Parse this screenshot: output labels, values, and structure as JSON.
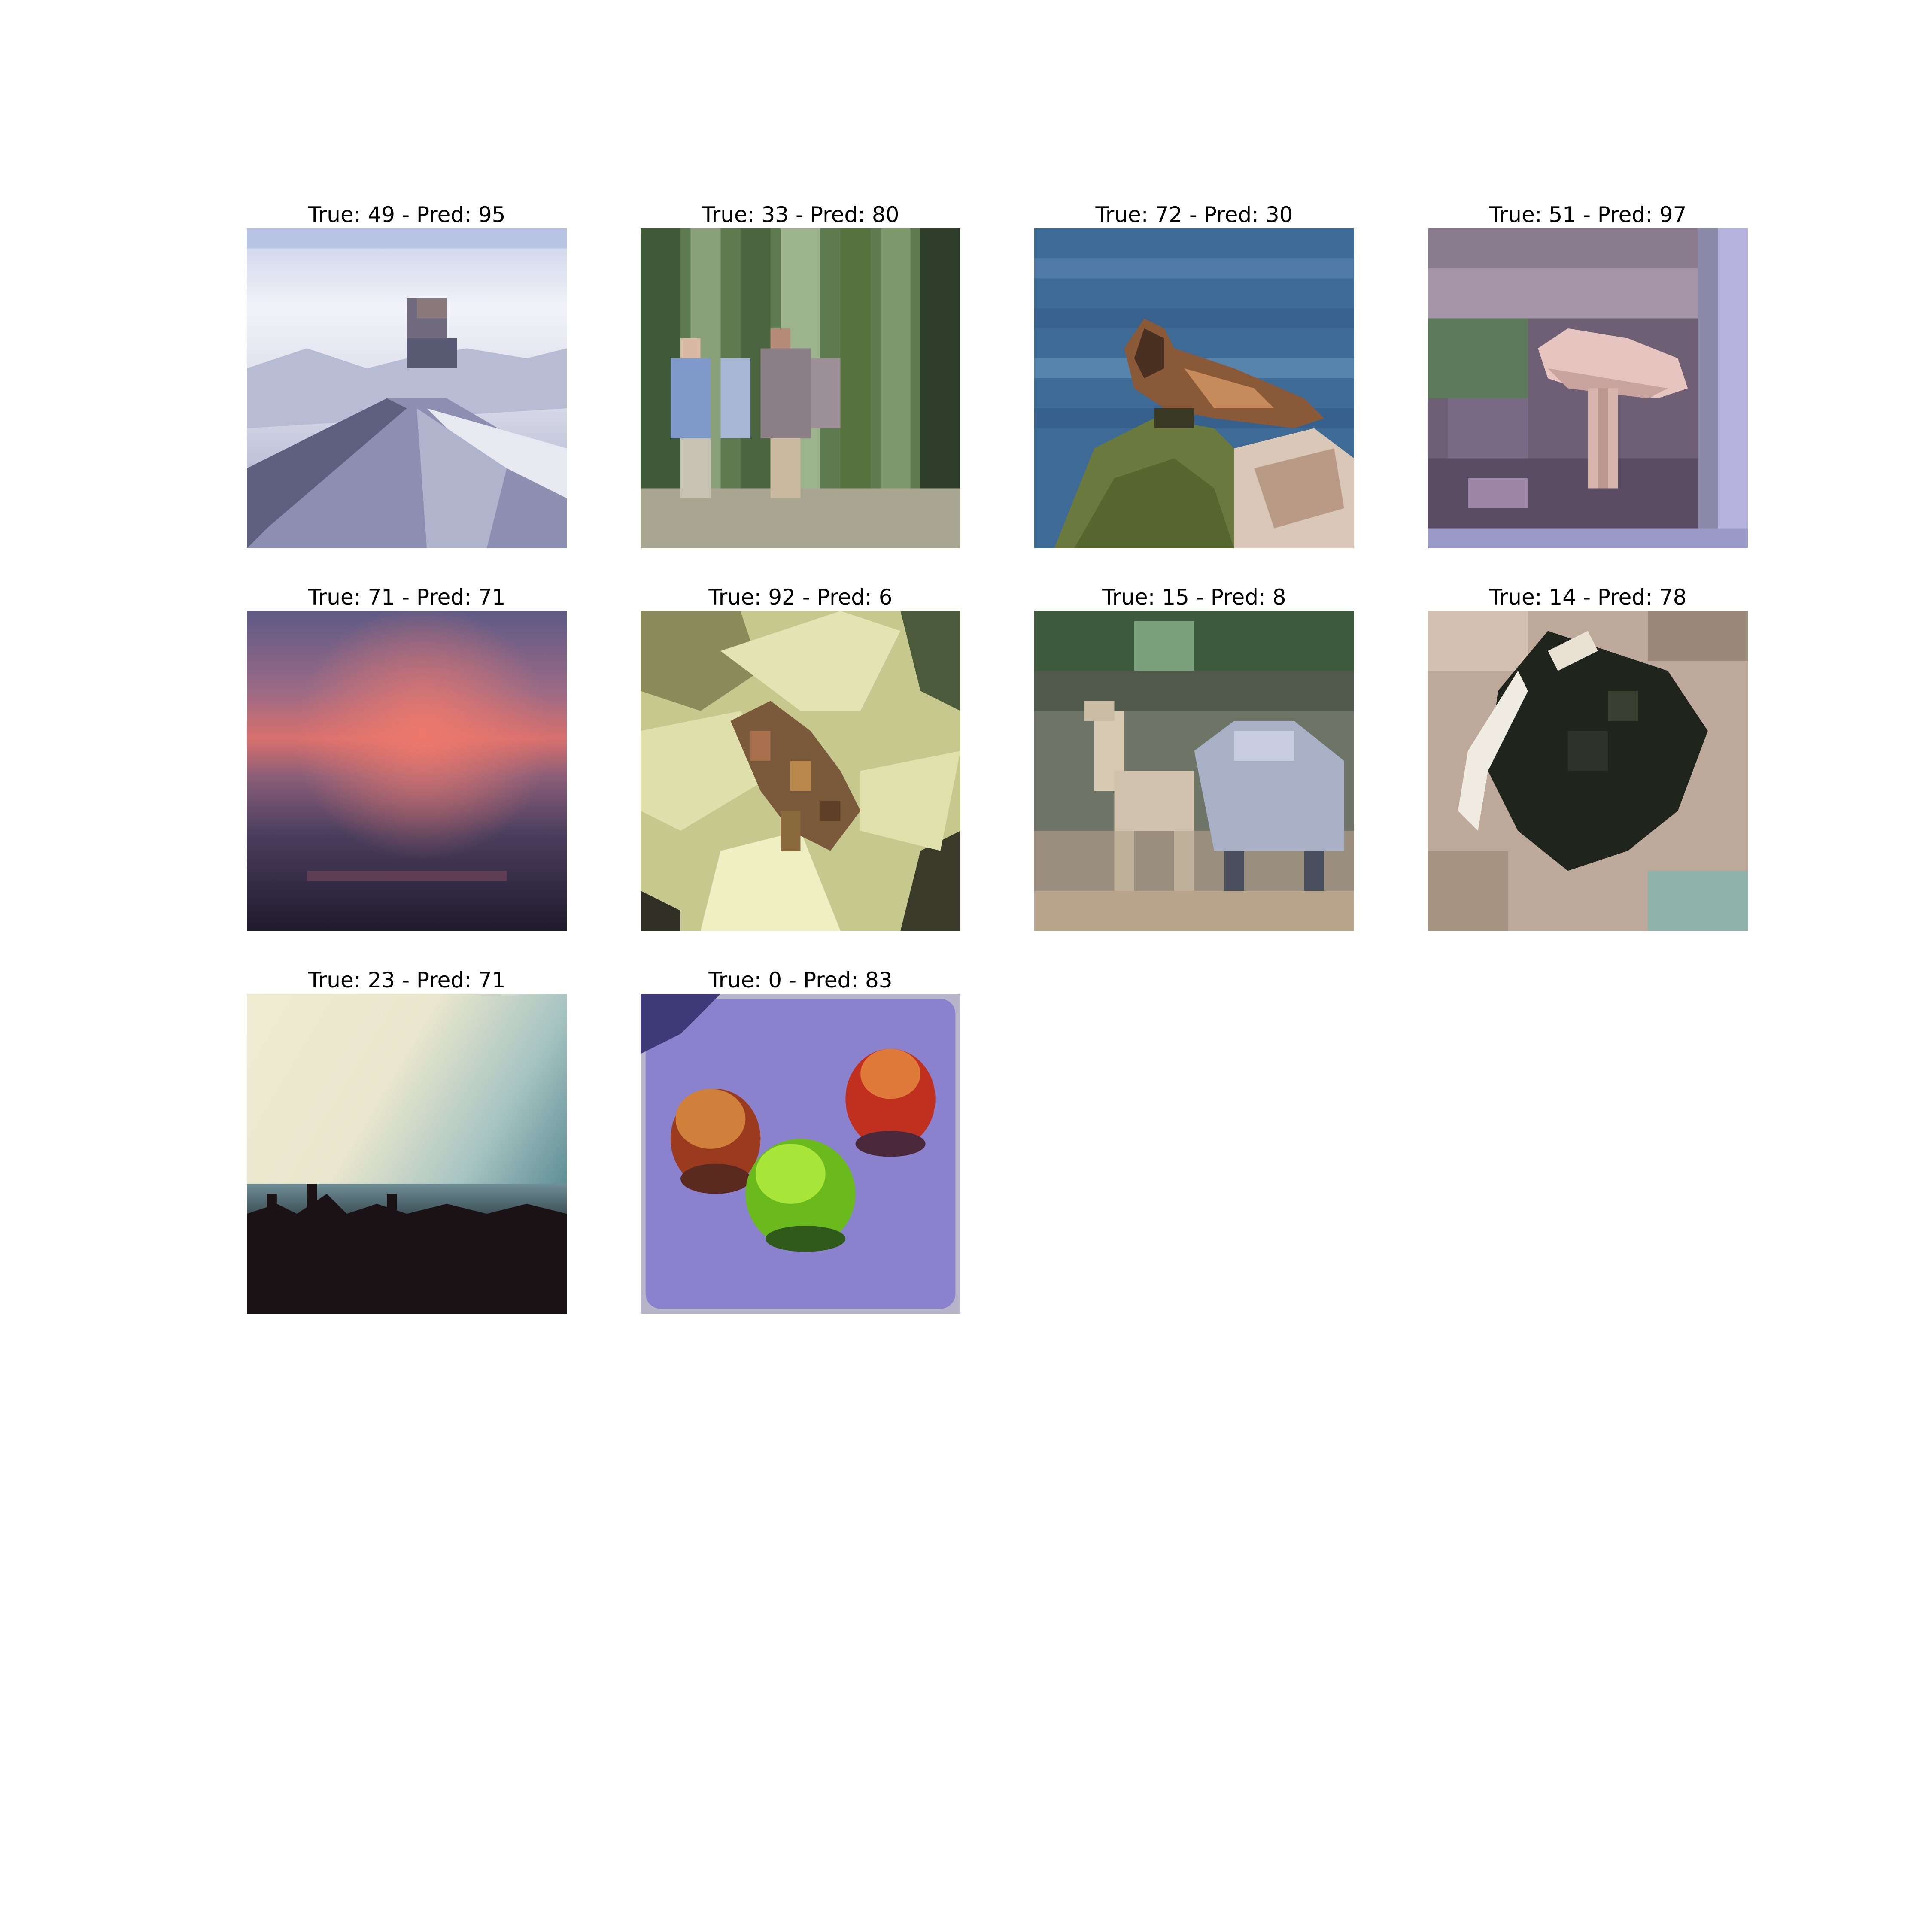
{
  "figure": {
    "panels": [
      {
        "title": "True: 49 - Pred: 95"
      },
      {
        "title": "True: 33 - Pred: 80"
      },
      {
        "title": "True: 72 - Pred: 30"
      },
      {
        "title": "True: 51 - Pred: 97"
      },
      {
        "title": "True: 71 - Pred: 71"
      },
      {
        "title": "True: 92 - Pred: 6"
      },
      {
        "title": "True: 15 - Pred: 8"
      },
      {
        "title": "True: 14 - Pred: 78"
      },
      {
        "title": "True: 23 - Pred: 71"
      },
      {
        "title": "True: 0 - Pred: 83"
      }
    ]
  }
}
